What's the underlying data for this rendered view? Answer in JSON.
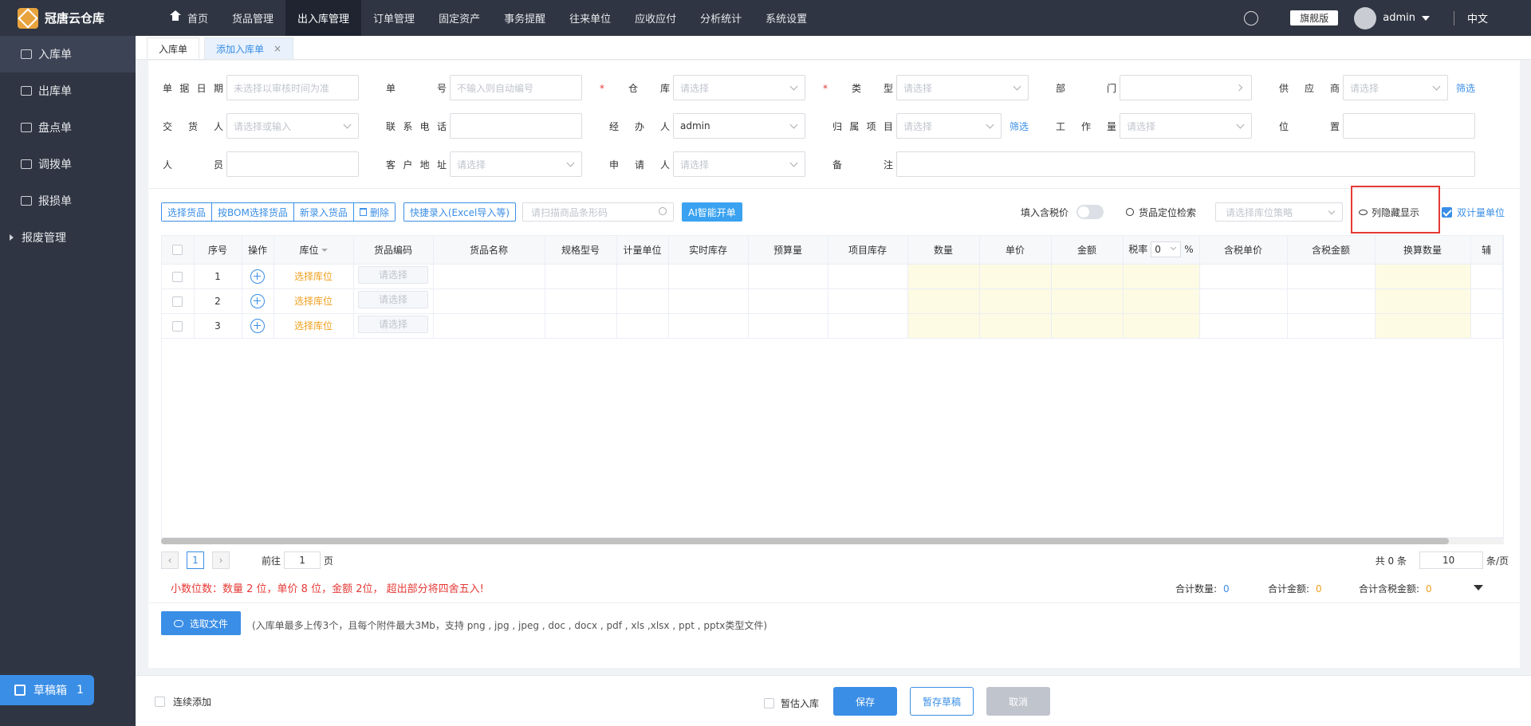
{
  "app": {
    "title": "冠唐云仓库"
  },
  "sidebar": {
    "items": [
      {
        "label": "入库单"
      },
      {
        "label": "出库单"
      },
      {
        "label": "盘点单"
      },
      {
        "label": "调拨单"
      },
      {
        "label": "报损单"
      },
      {
        "label": "报废管理"
      }
    ],
    "draft": {
      "label": "草稿箱",
      "count": "1"
    }
  },
  "topnav": {
    "items": [
      "首页",
      "货品管理",
      "出入库管理",
      "订单管理",
      "固定资产",
      "事务提醒",
      "往来单位",
      "应收应付",
      "分析统计",
      "系统设置"
    ],
    "edition": "旗舰版",
    "user": "admin",
    "lang": "中文"
  },
  "tabs": [
    {
      "label": "入库单"
    },
    {
      "label": "添加入库单"
    }
  ],
  "form": {
    "date_label": "单据日期",
    "date_ph": "未选择以审核时间为准",
    "no_label": "单号",
    "no_ph": "不输入则自动编号",
    "warehouse_label": "仓库",
    "warehouse_ph": "请选择",
    "type_label": "类型",
    "type_ph": "请选择",
    "dept_label": "部门",
    "supplier_label": "供应商",
    "supplier_ph": "请选择",
    "filter": "筛选",
    "deliverer_label": "交货人",
    "deliverer_ph": "请选择或输入",
    "phone_label": "联系电话",
    "handler_label": "经办人",
    "handler_val": "admin",
    "project_label": "归属项目",
    "project_ph": "请选择",
    "workload_label": "工作量",
    "workload_ph": "请选择",
    "position_label": "位置",
    "personnel_label": "人员",
    "address_label": "客户地址",
    "address_ph": "请选择",
    "applicant_label": "申请人",
    "applicant_ph": "请选择",
    "remark_label": "备注"
  },
  "toolbar": {
    "select_goods": "选择货品",
    "bom_select": "按BOM选择货品",
    "new_goods": "新录入货品",
    "delete": "删除",
    "quick_entry": "快捷录入(Excel导入等)",
    "scan_ph": "请扫描商品条形码",
    "ai": "AI智能开单",
    "tax_price": "填入含税价",
    "locate_search": "货品定位检索",
    "strategy_ph": "请选择库位策略",
    "col_hide": "列隐藏显示",
    "dual_unit": "双计量单位"
  },
  "table": {
    "headers": [
      "序号",
      "操作",
      "库位",
      "货品编码",
      "货品名称",
      "规格型号",
      "计量单位",
      "实时库存",
      "预算量",
      "项目库存",
      "数量",
      "单价",
      "金额",
      "税率",
      "%",
      "含税单价",
      "含税金额",
      "换算数量",
      "辅"
    ],
    "tax_default": "0",
    "rows": [
      {
        "no": "1",
        "loc": "选择库位",
        "code_ph": "请选择"
      },
      {
        "no": "2",
        "loc": "选择库位",
        "code_ph": "请选择"
      },
      {
        "no": "3",
        "loc": "选择库位",
        "code_ph": "请选择"
      }
    ]
  },
  "pager": {
    "page": "1",
    "goto_label": "前往",
    "goto_val": "1",
    "page_label": "页",
    "total": "共 0 条",
    "size": "10",
    "size_unit": "条/页"
  },
  "notes": {
    "decimal": "小数位数：数量 2 位，单价 8 位，金额 2位， 超出部分将四舍五入!",
    "total_qty_label": "合计数量:",
    "total_qty": "0",
    "total_amt_label": "合计金额:",
    "total_amt": "0",
    "total_tax_label": "合计含税金额:",
    "total_tax": "0",
    "upload": "选取文件",
    "upload_note": "(入库单最多上传3个，且每个附件最大3Mb，支持 png , jpg , jpeg , doc , docx , pdf , xls ,xlsx , ppt , pptx类型文件)"
  },
  "footer": {
    "continuous": "连续添加",
    "estimate": "暂估入库",
    "save": "保存",
    "draft": "暂存草稿",
    "cancel": "取消"
  },
  "colors": {
    "primary": "#3a8ee6",
    "sidebar": "#2f3542",
    "warning": "#f0a020",
    "danger": "#e53935"
  }
}
